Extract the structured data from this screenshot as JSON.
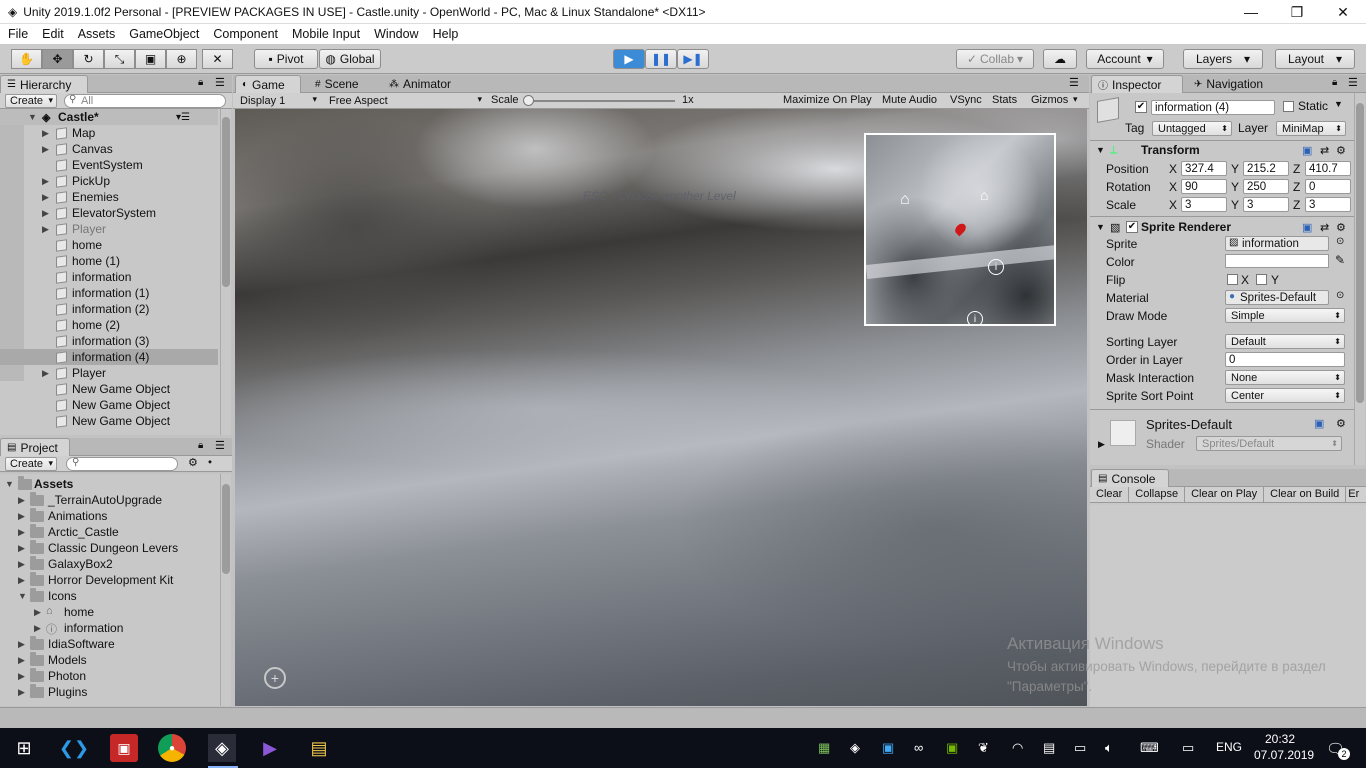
{
  "window": {
    "title": "Unity 2019.1.0f2 Personal - [PREVIEW PACKAGES IN USE] - Castle.unity - OpenWorld - PC, Mac & Linux Standalone* <DX11>",
    "controls": {
      "minimize": "—",
      "restore": "❐",
      "close": "✕"
    }
  },
  "menu": [
    "File",
    "Edit",
    "Assets",
    "GameObject",
    "Component",
    "Mobile Input",
    "Window",
    "Help"
  ],
  "toolbar": {
    "pivot": "Pivot",
    "global": "Global",
    "collab": "Collab",
    "account": "Account",
    "layers": "Layers",
    "layout": "Layout"
  },
  "hierarchy": {
    "tab": "Hierarchy",
    "create": "Create",
    "search_placeholder": "All",
    "scene": "Castle*",
    "items": [
      {
        "label": "Map",
        "expand": true
      },
      {
        "label": "Canvas",
        "expand": true
      },
      {
        "label": "EventSystem",
        "expand": false
      },
      {
        "label": "PickUp",
        "expand": true
      },
      {
        "label": "Enemies",
        "expand": true
      },
      {
        "label": "ElevatorSystem",
        "expand": true
      },
      {
        "label": "Player",
        "expand": true,
        "dim": true
      },
      {
        "label": "home",
        "expand": false
      },
      {
        "label": "home (1)",
        "expand": false
      },
      {
        "label": "information",
        "expand": false
      },
      {
        "label": "information (1)",
        "expand": false
      },
      {
        "label": "information (2)",
        "expand": false
      },
      {
        "label": "home (2)",
        "expand": false
      },
      {
        "label": "information (3)",
        "expand": false
      },
      {
        "label": "information (4)",
        "expand": false,
        "selected": true
      },
      {
        "label": "Player",
        "expand": true
      },
      {
        "label": "New Game Object",
        "expand": false
      },
      {
        "label": "New Game Object",
        "expand": false
      },
      {
        "label": "New Game Object",
        "expand": false
      }
    ]
  },
  "project": {
    "tab": "Project",
    "create": "Create",
    "root": "Assets",
    "items": [
      {
        "label": "_TerrainAutoUpgrade",
        "indent": 1
      },
      {
        "label": "Animations",
        "indent": 1
      },
      {
        "label": "Arctic_Castle",
        "indent": 1
      },
      {
        "label": "Classic Dungeon Levers",
        "indent": 1
      },
      {
        "label": "GalaxyBox2",
        "indent": 1
      },
      {
        "label": "Horror Development Kit",
        "indent": 1
      },
      {
        "label": "Icons",
        "indent": 1,
        "open": true
      },
      {
        "label": "home",
        "indent": 2
      },
      {
        "label": "information",
        "indent": 2
      },
      {
        "label": "IdiaSoftware",
        "indent": 1
      },
      {
        "label": "Models",
        "indent": 1
      },
      {
        "label": "Photon",
        "indent": 1
      },
      {
        "label": "Plugins",
        "indent": 1
      }
    ]
  },
  "game": {
    "tabs": [
      "Game",
      "Scene",
      "Animator"
    ],
    "display": "Display 1",
    "aspect": "Free Aspect",
    "scale_label": "Scale",
    "scale_value": "1x",
    "options": [
      "Maximize On Play",
      "Mute Audio",
      "VSync",
      "Stats",
      "Gizmos"
    ],
    "hint": "ESC - Choose another Level",
    "watermark_title": "Активация Windows",
    "watermark_text": "Чтобы активировать Windows, перейдите в раздел \"Параметры\"."
  },
  "inspector": {
    "tabs": [
      "Inspector",
      "Navigation"
    ],
    "object_name": "information (4)",
    "static_label": "Static",
    "tag_label": "Tag",
    "tag_value": "Untagged",
    "layer_label": "Layer",
    "layer_value": "MiniMap",
    "transform": {
      "title": "Transform",
      "position": {
        "label": "Position",
        "x": "327.4",
        "y": "215.2",
        "z": "410.7"
      },
      "rotation": {
        "label": "Rotation",
        "x": "90",
        "y": "250",
        "z": "0"
      },
      "scale": {
        "label": "Scale",
        "x": "3",
        "y": "3",
        "z": "3"
      }
    },
    "sprite_renderer": {
      "title": "Sprite Renderer",
      "sprite_label": "Sprite",
      "sprite_value": "information",
      "color_label": "Color",
      "flip_label": "Flip",
      "flip_x": "X",
      "flip_y": "Y",
      "material_label": "Material",
      "material_value": "Sprites-Default",
      "draw_mode_label": "Draw Mode",
      "draw_mode_value": "Simple",
      "sorting_layer_label": "Sorting Layer",
      "sorting_layer_value": "Default",
      "order_label": "Order in Layer",
      "order_value": "0",
      "mask_label": "Mask Interaction",
      "mask_value": "None",
      "sort_point_label": "Sprite Sort Point",
      "sort_point_value": "Center"
    },
    "material": {
      "name": "Sprites-Default",
      "shader_label": "Shader",
      "shader_value": "Sprites/Default"
    }
  },
  "console": {
    "tab": "Console",
    "buttons": [
      "Clear",
      "Collapse",
      "Clear on Play",
      "Clear on Build",
      "Er"
    ]
  },
  "taskbar": {
    "lang": "ENG",
    "time": "20:32",
    "date": "07.07.2019",
    "notifications": "2"
  }
}
